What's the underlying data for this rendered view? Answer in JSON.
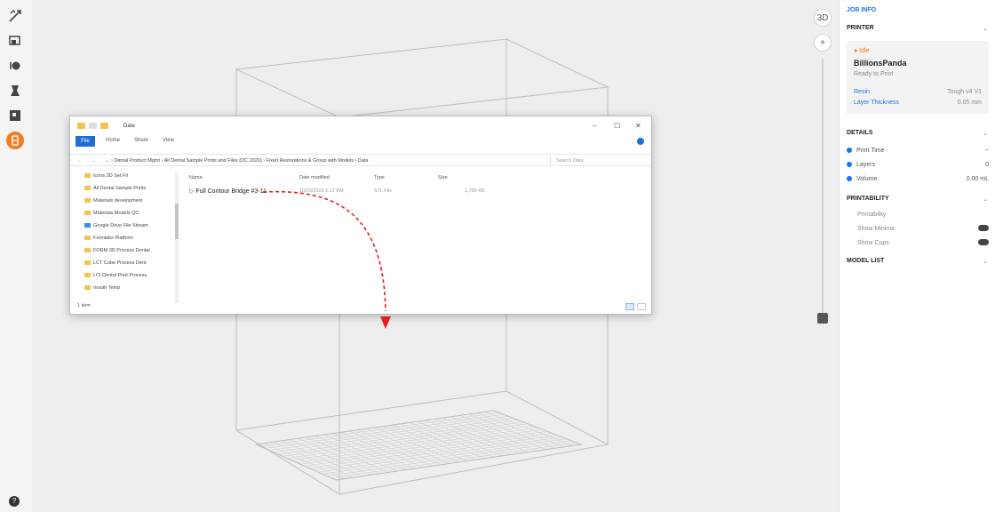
{
  "toolbar": {
    "tools": [
      {
        "icon": "move-tool-icon"
      },
      {
        "icon": "scale-tool-icon"
      },
      {
        "icon": "rotate-tool-icon"
      },
      {
        "icon": "mirror-tool-icon"
      },
      {
        "icon": "per-model-settings-icon"
      },
      {
        "icon": "support-blocker-icon",
        "active": true
      }
    ],
    "help_icon": "help-circle-icon"
  },
  "view_controls": {
    "top_button": "3D",
    "mid_button": "+"
  },
  "right_panel": {
    "top_link": "JOB INFO",
    "printer_header": "PRINTER",
    "printer_status": "● Idle",
    "printer_name": "BillionsPanda",
    "printer_sub": "Ready to Print",
    "material_label": "Resin",
    "material_value": "Tough v4 V1",
    "layer_label": "Layer Thickness",
    "layer_value": "0.05 mm",
    "details_header": "DETAILS",
    "details": [
      {
        "label": "Print Time",
        "value": "--"
      },
      {
        "label": "Layers",
        "value": "0"
      },
      {
        "label": "Volume",
        "value": "0.00 mL"
      }
    ],
    "printability_header": "PRINTABILITY",
    "printability": [
      {
        "label": "Printability"
      },
      {
        "label": "Show Minima",
        "toggle": true
      },
      {
        "label": "Show Cups",
        "toggle": true
      }
    ],
    "model_list_header": "MODEL LIST"
  },
  "explorer": {
    "title": "Data",
    "ribbon_tabs": [
      "File",
      "Home",
      "Share",
      "View"
    ],
    "address": "›  Dental Product Mgmt  ›  All Dental Sample Prints and Files (DC 2020)  ›  Fixed Restorations & Group with Models  ›  Data",
    "search_placeholder": "Search Data",
    "nav_items": [
      "Icons 3D Set Fil",
      "All Dental Sample Prints",
      "Materials development",
      "Materials Models QC",
      "Google Drive File Stream",
      "Formlabs Platform",
      "FORM 3D Process Dental",
      "LCT Cube Process Dent",
      "LCI Dental Print Process",
      "mouth Temp"
    ],
    "columns": [
      "Name",
      "Date modified",
      "Type",
      "Size"
    ],
    "file": {
      "name": "Full Contour Bridge #3-11",
      "date": "10/29/2020 2:12 PM",
      "type": "STL File",
      "size": "1,795 KB"
    },
    "status": "1 item"
  },
  "annotation": {
    "arrow_color": "#e02020"
  }
}
